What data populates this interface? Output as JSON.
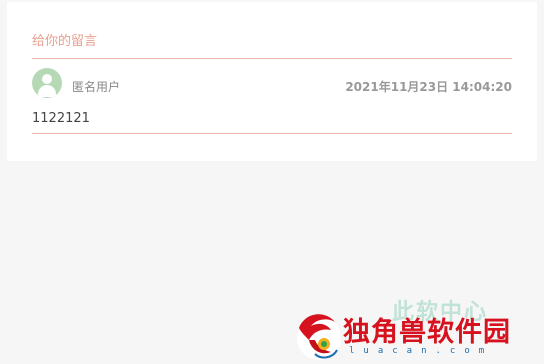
{
  "section": {
    "title": "给你的留言"
  },
  "comments": [
    {
      "avatar_icon": "user-avatar-icon",
      "author": "匿名用户",
      "time": "2021年11月23日 14:04:20",
      "text": "1122121"
    }
  ],
  "watermark": {
    "faint_text": "此软中心",
    "name": "独角兽软件园",
    "domain": "luacan.com",
    "brand_color": "#d6121e"
  },
  "colors": {
    "accent": "#e8a090",
    "divider": "#eab8aa",
    "avatar_bg": "#b5d8b5"
  }
}
